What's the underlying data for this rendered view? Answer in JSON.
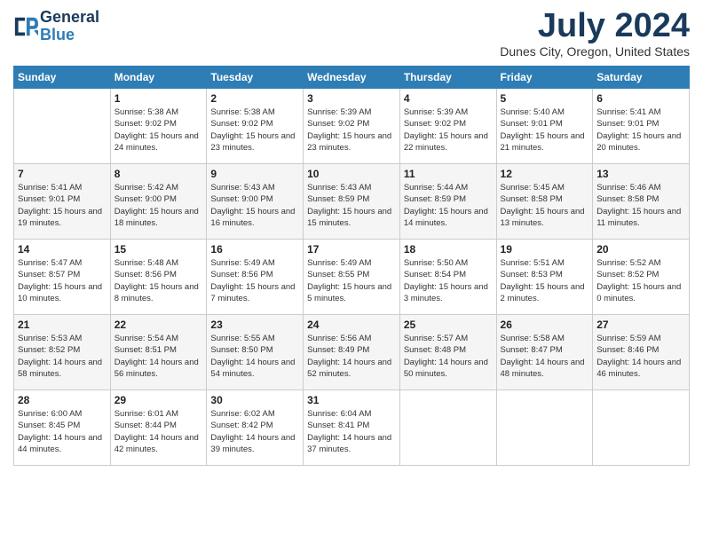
{
  "header": {
    "logo_line1": "General",
    "logo_line2": "Blue",
    "month_title": "July 2024",
    "location": "Dunes City, Oregon, United States"
  },
  "days_of_week": [
    "Sunday",
    "Monday",
    "Tuesday",
    "Wednesday",
    "Thursday",
    "Friday",
    "Saturday"
  ],
  "weeks": [
    [
      {
        "num": "",
        "sunrise": "",
        "sunset": "",
        "daylight": ""
      },
      {
        "num": "1",
        "sunrise": "5:38 AM",
        "sunset": "9:02 PM",
        "daylight": "15 hours and 24 minutes."
      },
      {
        "num": "2",
        "sunrise": "5:38 AM",
        "sunset": "9:02 PM",
        "daylight": "15 hours and 23 minutes."
      },
      {
        "num": "3",
        "sunrise": "5:39 AM",
        "sunset": "9:02 PM",
        "daylight": "15 hours and 23 minutes."
      },
      {
        "num": "4",
        "sunrise": "5:39 AM",
        "sunset": "9:02 PM",
        "daylight": "15 hours and 22 minutes."
      },
      {
        "num": "5",
        "sunrise": "5:40 AM",
        "sunset": "9:01 PM",
        "daylight": "15 hours and 21 minutes."
      },
      {
        "num": "6",
        "sunrise": "5:41 AM",
        "sunset": "9:01 PM",
        "daylight": "15 hours and 20 minutes."
      }
    ],
    [
      {
        "num": "7",
        "sunrise": "5:41 AM",
        "sunset": "9:01 PM",
        "daylight": "15 hours and 19 minutes."
      },
      {
        "num": "8",
        "sunrise": "5:42 AM",
        "sunset": "9:00 PM",
        "daylight": "15 hours and 18 minutes."
      },
      {
        "num": "9",
        "sunrise": "5:43 AM",
        "sunset": "9:00 PM",
        "daylight": "15 hours and 16 minutes."
      },
      {
        "num": "10",
        "sunrise": "5:43 AM",
        "sunset": "8:59 PM",
        "daylight": "15 hours and 15 minutes."
      },
      {
        "num": "11",
        "sunrise": "5:44 AM",
        "sunset": "8:59 PM",
        "daylight": "15 hours and 14 minutes."
      },
      {
        "num": "12",
        "sunrise": "5:45 AM",
        "sunset": "8:58 PM",
        "daylight": "15 hours and 13 minutes."
      },
      {
        "num": "13",
        "sunrise": "5:46 AM",
        "sunset": "8:58 PM",
        "daylight": "15 hours and 11 minutes."
      }
    ],
    [
      {
        "num": "14",
        "sunrise": "5:47 AM",
        "sunset": "8:57 PM",
        "daylight": "15 hours and 10 minutes."
      },
      {
        "num": "15",
        "sunrise": "5:48 AM",
        "sunset": "8:56 PM",
        "daylight": "15 hours and 8 minutes."
      },
      {
        "num": "16",
        "sunrise": "5:49 AM",
        "sunset": "8:56 PM",
        "daylight": "15 hours and 7 minutes."
      },
      {
        "num": "17",
        "sunrise": "5:49 AM",
        "sunset": "8:55 PM",
        "daylight": "15 hours and 5 minutes."
      },
      {
        "num": "18",
        "sunrise": "5:50 AM",
        "sunset": "8:54 PM",
        "daylight": "15 hours and 3 minutes."
      },
      {
        "num": "19",
        "sunrise": "5:51 AM",
        "sunset": "8:53 PM",
        "daylight": "15 hours and 2 minutes."
      },
      {
        "num": "20",
        "sunrise": "5:52 AM",
        "sunset": "8:52 PM",
        "daylight": "15 hours and 0 minutes."
      }
    ],
    [
      {
        "num": "21",
        "sunrise": "5:53 AM",
        "sunset": "8:52 PM",
        "daylight": "14 hours and 58 minutes."
      },
      {
        "num": "22",
        "sunrise": "5:54 AM",
        "sunset": "8:51 PM",
        "daylight": "14 hours and 56 minutes."
      },
      {
        "num": "23",
        "sunrise": "5:55 AM",
        "sunset": "8:50 PM",
        "daylight": "14 hours and 54 minutes."
      },
      {
        "num": "24",
        "sunrise": "5:56 AM",
        "sunset": "8:49 PM",
        "daylight": "14 hours and 52 minutes."
      },
      {
        "num": "25",
        "sunrise": "5:57 AM",
        "sunset": "8:48 PM",
        "daylight": "14 hours and 50 minutes."
      },
      {
        "num": "26",
        "sunrise": "5:58 AM",
        "sunset": "8:47 PM",
        "daylight": "14 hours and 48 minutes."
      },
      {
        "num": "27",
        "sunrise": "5:59 AM",
        "sunset": "8:46 PM",
        "daylight": "14 hours and 46 minutes."
      }
    ],
    [
      {
        "num": "28",
        "sunrise": "6:00 AM",
        "sunset": "8:45 PM",
        "daylight": "14 hours and 44 minutes."
      },
      {
        "num": "29",
        "sunrise": "6:01 AM",
        "sunset": "8:44 PM",
        "daylight": "14 hours and 42 minutes."
      },
      {
        "num": "30",
        "sunrise": "6:02 AM",
        "sunset": "8:42 PM",
        "daylight": "14 hours and 39 minutes."
      },
      {
        "num": "31",
        "sunrise": "6:04 AM",
        "sunset": "8:41 PM",
        "daylight": "14 hours and 37 minutes."
      },
      {
        "num": "",
        "sunrise": "",
        "sunset": "",
        "daylight": ""
      },
      {
        "num": "",
        "sunrise": "",
        "sunset": "",
        "daylight": ""
      },
      {
        "num": "",
        "sunrise": "",
        "sunset": "",
        "daylight": ""
      }
    ]
  ]
}
